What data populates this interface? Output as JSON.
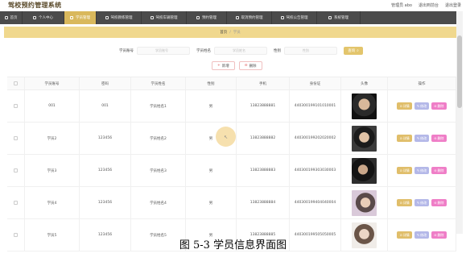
{
  "app": {
    "title": "驾校预约管理系统",
    "user_label": "管理员 abo",
    "back_front": "退出到前台",
    "logout": "退出登录"
  },
  "nav": [
    {
      "label": "首页",
      "icon": "home-icon",
      "active": false,
      "w": 28
    },
    {
      "label": "个人中心",
      "icon": "user-icon",
      "active": false,
      "w": 52
    },
    {
      "label": "学员管理",
      "icon": "student-icon",
      "active": true,
      "w": 40
    },
    {
      "label": "驾校教练管理",
      "icon": "coach-icon",
      "active": false,
      "w": 56
    },
    {
      "label": "驾校车辆管理",
      "icon": "car-icon",
      "active": false,
      "w": 56
    },
    {
      "label": "预约管理",
      "icon": "calendar-icon",
      "active": false,
      "w": 50
    },
    {
      "label": "取消预约管理",
      "icon": "cancel-icon",
      "active": false,
      "w": 56
    },
    {
      "label": "驾校公告管理",
      "icon": "notice-icon",
      "active": false,
      "w": 56
    },
    {
      "label": "系统管理",
      "icon": "settings-icon",
      "active": false,
      "w": 54
    }
  ],
  "breadcrumb": {
    "home": "首页",
    "sep": "/",
    "current": "学员"
  },
  "search": {
    "field1_label": "学员账号",
    "field1_placeholder": "学员账号",
    "field2_label": "学员姓名",
    "field2_placeholder": "学员姓名",
    "field3_label": "性别",
    "field3_placeholder": "性别",
    "button": "查询"
  },
  "actions": {
    "add": "新增",
    "delete": "删除"
  },
  "table": {
    "headers": [
      "学员账号",
      "密码",
      "学员姓名",
      "性别",
      "手机",
      "身份证",
      "头像",
      "操作"
    ],
    "rows": [
      {
        "account": "001",
        "password": "001",
        "name": "学员姓名1",
        "gender": "男",
        "phone": "13823888881",
        "idcard": "440300199101010001"
      },
      {
        "account": "学员2",
        "password": "123456",
        "name": "学员姓名2",
        "gender": "男",
        "phone": "13823888882",
        "idcard": "440300199202020002"
      },
      {
        "account": "学员3",
        "password": "123456",
        "name": "学员姓名3",
        "gender": "男",
        "phone": "13823888883",
        "idcard": "440300199303030003"
      },
      {
        "account": "学员4",
        "password": "123456",
        "name": "学员姓名4",
        "gender": "男",
        "phone": "13823888884",
        "idcard": "440300199404040004"
      },
      {
        "account": "学员5",
        "password": "123456",
        "name": "学员姓名5",
        "gender": "男",
        "phone": "13823888885",
        "idcard": "440300199505050005"
      }
    ],
    "op_detail": "详情",
    "op_edit": "修改",
    "op_delete": "删除"
  },
  "caption": "图 5-3 学员信息界面图",
  "colors": {
    "accent": "#d9b85c",
    "navbar": "#4b4b4b",
    "detail": "#e0be6a",
    "edit": "#b4b8e8",
    "delete": "#ef7ec7"
  }
}
